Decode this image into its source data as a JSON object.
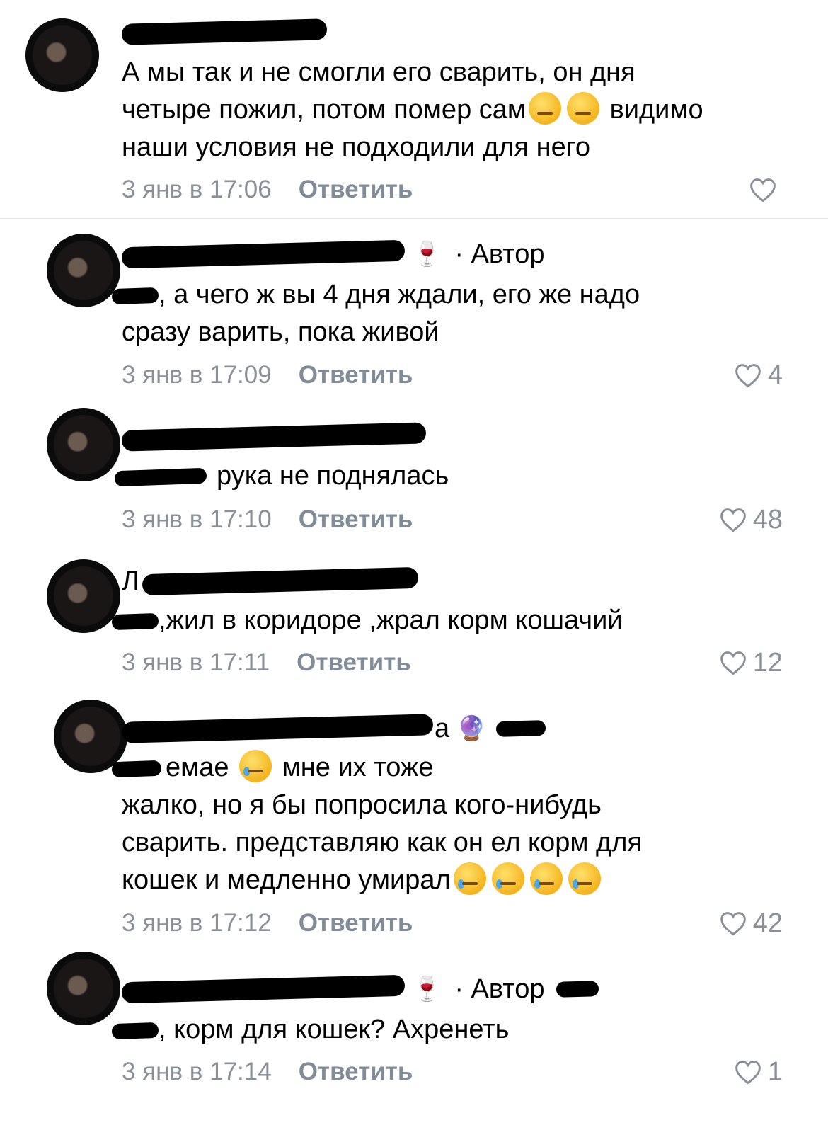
{
  "comments": [
    {
      "author_visible": "",
      "is_author": false,
      "text": "А мы так и не смогли его сварить, он дня\nчетыре пожил, потом помер сам",
      "text_tail": " видимо\nнаши условия не подходили для него",
      "date": "3 янв в 17:06",
      "reply": "Ответить",
      "likes": ""
    },
    {
      "author_visible": "",
      "is_author": true,
      "author_label": "· Автор",
      "text": ", а чего ж вы 4 дня ждали, его же надо\nсразу варить, пока живой",
      "date": "3 янв в 17:09",
      "reply": "Ответить",
      "likes": "4"
    },
    {
      "author_visible": "",
      "is_author": false,
      "text": "рука не поднялась",
      "date": "3 янв в 17:10",
      "reply": "Ответить",
      "likes": "48"
    },
    {
      "author_visible": "Л",
      "is_author": false,
      "text": ",жил в коридоре ,жрал корм кошачий",
      "date": "3 янв в 17:11",
      "reply": "Ответить",
      "likes": "12"
    },
    {
      "author_visible": "а",
      "is_author": false,
      "text_a": "емае",
      "text_b": " мне их тоже\nжалко, но я бы попросила кого-нибудь\nсварить. представляю как он ел корм для\nкошек и медленно умирал",
      "date": "3 янв в 17:12",
      "reply": "Ответить",
      "likes": "42"
    },
    {
      "author_visible": "",
      "is_author": true,
      "author_label": "· Автор",
      "text": ", корм для кошек? Ахренеть",
      "date": "3 янв в 17:14",
      "reply": "Ответить",
      "likes": "1"
    }
  ],
  "icons": {
    "heart": "heart-icon",
    "wine": "wine-glass-icon",
    "gem": "pink-crystal-icon"
  },
  "colors": {
    "meta_gray": "#8a9097",
    "reply_gray": "#818c99",
    "divider": "#e3e4e8"
  }
}
